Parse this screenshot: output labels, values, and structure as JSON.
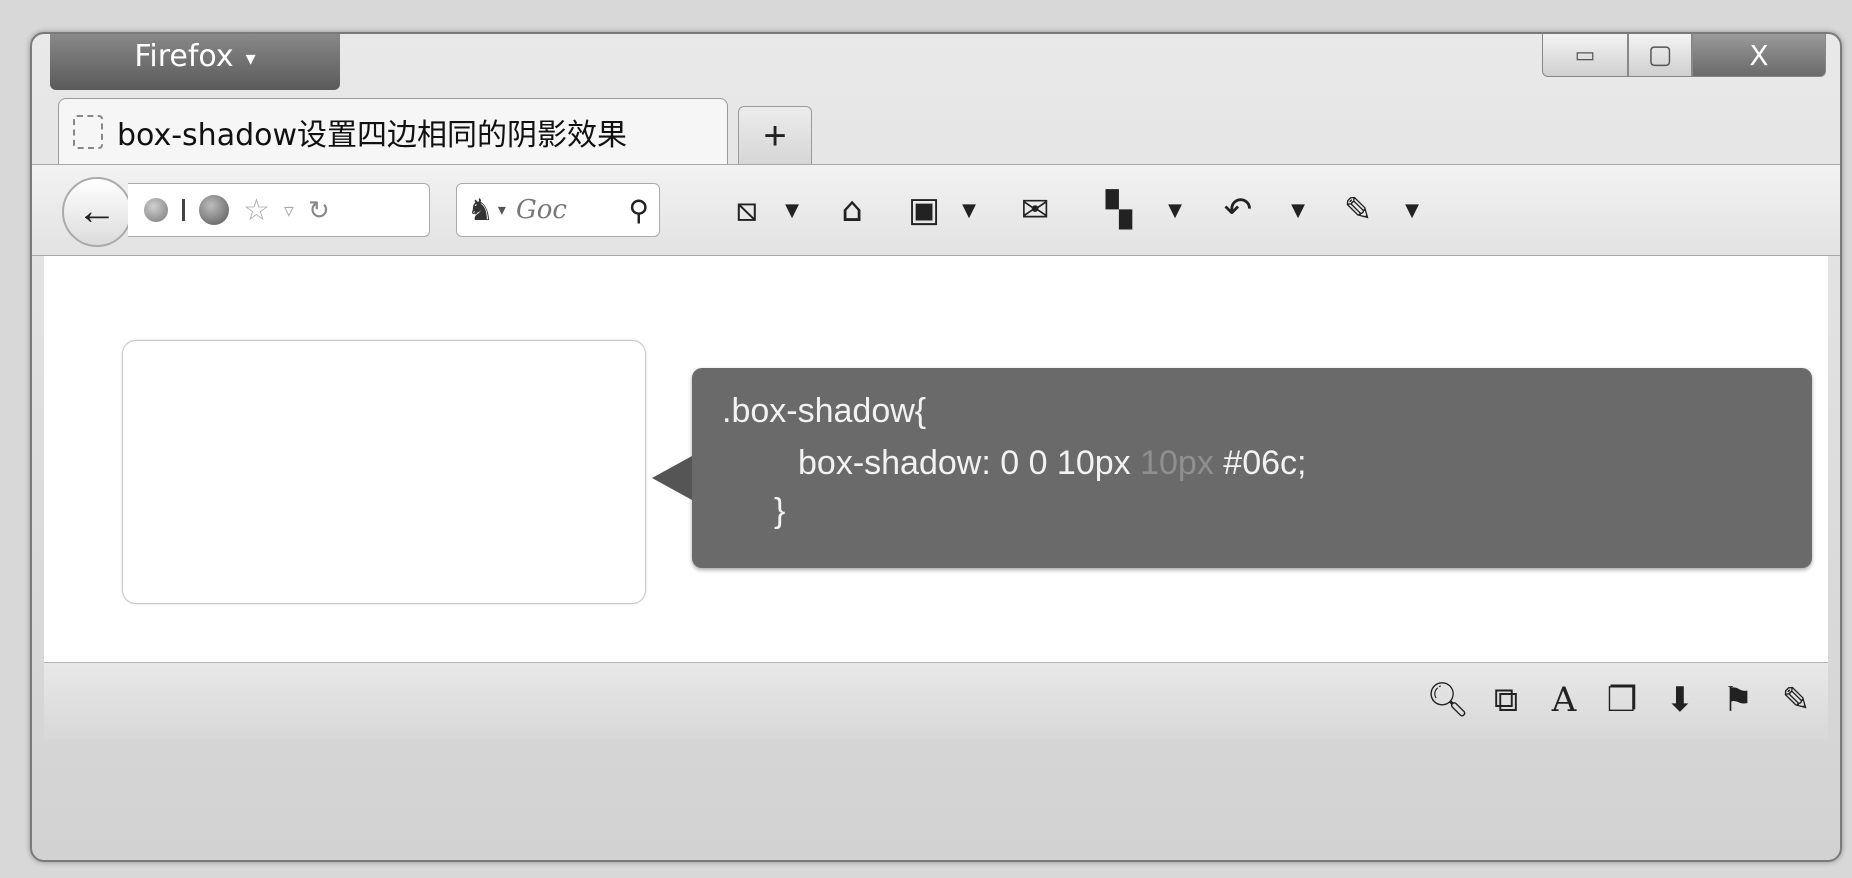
{
  "window": {
    "menu_label": "Firefox",
    "menu_caret": "▾",
    "minimize_glyph": "▭",
    "maximize_glyph": "▢",
    "close_glyph": "X"
  },
  "tabs": [
    {
      "title": "box-shadow设置四边相同的阴影效果"
    }
  ],
  "new_tab_label": "+",
  "toolbar": {
    "back_glyph": "←",
    "search_placeholder": "Goc",
    "icons": [
      "page-tool-icon",
      "dropdown-caret-icon",
      "home-icon",
      "bookmark-menu-icon",
      "dropdown-caret-icon",
      "mail-icon",
      "addons-icon",
      "dropdown-caret-icon",
      "history-icon",
      "dropdown-caret-icon",
      "tools-icon",
      "dropdown-caret-icon"
    ]
  },
  "callout": {
    "line1": ".box-shadow{",
    "line2_a": "box-shadow: 0 0 10px ",
    "line2_b": "10px",
    "line2_c": " #06c;",
    "line3": "}"
  },
  "colors": {
    "callout_bg": "#6a6a6a",
    "window_chrome": "#d2d2d2"
  }
}
